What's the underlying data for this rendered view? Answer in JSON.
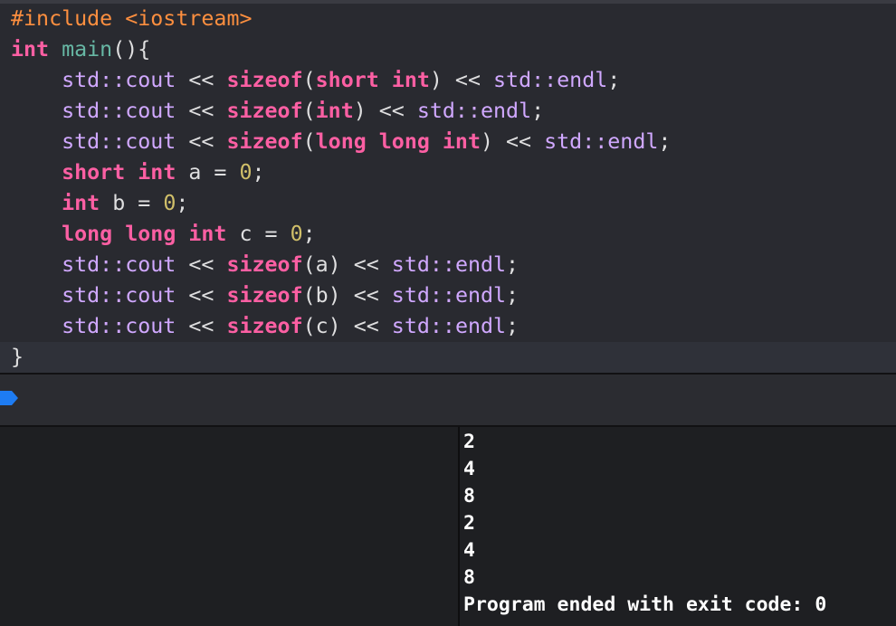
{
  "editor": {
    "lines": [
      [
        {
          "t": "#include <iostream>",
          "c": "pre"
        }
      ],
      [
        {
          "t": "int",
          "c": "kw"
        },
        {
          "t": " ",
          "c": "plain"
        },
        {
          "t": "main",
          "c": "func"
        },
        {
          "t": "(){",
          "c": "plain"
        }
      ],
      [
        {
          "t": "    std::",
          "c": "ns"
        },
        {
          "t": "cout",
          "c": "ns"
        },
        {
          "t": " << ",
          "c": "plain"
        },
        {
          "t": "sizeof",
          "c": "kw"
        },
        {
          "t": "(",
          "c": "plain"
        },
        {
          "t": "short int",
          "c": "kw"
        },
        {
          "t": ") << ",
          "c": "plain"
        },
        {
          "t": "std::",
          "c": "ns"
        },
        {
          "t": "endl",
          "c": "ns"
        },
        {
          "t": ";",
          "c": "plain"
        }
      ],
      [
        {
          "t": "    std::",
          "c": "ns"
        },
        {
          "t": "cout",
          "c": "ns"
        },
        {
          "t": " << ",
          "c": "plain"
        },
        {
          "t": "sizeof",
          "c": "kw"
        },
        {
          "t": "(",
          "c": "plain"
        },
        {
          "t": "int",
          "c": "kw"
        },
        {
          "t": ") << ",
          "c": "plain"
        },
        {
          "t": "std::",
          "c": "ns"
        },
        {
          "t": "endl",
          "c": "ns"
        },
        {
          "t": ";",
          "c": "plain"
        }
      ],
      [
        {
          "t": "    std::",
          "c": "ns"
        },
        {
          "t": "cout",
          "c": "ns"
        },
        {
          "t": " << ",
          "c": "plain"
        },
        {
          "t": "sizeof",
          "c": "kw"
        },
        {
          "t": "(",
          "c": "plain"
        },
        {
          "t": "long long int",
          "c": "kw"
        },
        {
          "t": ") << ",
          "c": "plain"
        },
        {
          "t": "std::",
          "c": "ns"
        },
        {
          "t": "endl",
          "c": "ns"
        },
        {
          "t": ";",
          "c": "plain"
        }
      ],
      [
        {
          "t": "    ",
          "c": "plain"
        },
        {
          "t": "short int",
          "c": "kw"
        },
        {
          "t": " a = ",
          "c": "plain"
        },
        {
          "t": "0",
          "c": "num"
        },
        {
          "t": ";",
          "c": "plain"
        }
      ],
      [
        {
          "t": "    ",
          "c": "plain"
        },
        {
          "t": "int",
          "c": "kw"
        },
        {
          "t": " b = ",
          "c": "plain"
        },
        {
          "t": "0",
          "c": "num"
        },
        {
          "t": ";",
          "c": "plain"
        }
      ],
      [
        {
          "t": "    ",
          "c": "plain"
        },
        {
          "t": "long long int",
          "c": "kw"
        },
        {
          "t": " c = ",
          "c": "plain"
        },
        {
          "t": "0",
          "c": "num"
        },
        {
          "t": ";",
          "c": "plain"
        }
      ],
      [
        {
          "t": "    std::",
          "c": "ns"
        },
        {
          "t": "cout",
          "c": "ns"
        },
        {
          "t": " << ",
          "c": "plain"
        },
        {
          "t": "sizeof",
          "c": "kw"
        },
        {
          "t": "(a) << ",
          "c": "plain"
        },
        {
          "t": "std::",
          "c": "ns"
        },
        {
          "t": "endl",
          "c": "ns"
        },
        {
          "t": ";",
          "c": "plain"
        }
      ],
      [
        {
          "t": "    std::",
          "c": "ns"
        },
        {
          "t": "cout",
          "c": "ns"
        },
        {
          "t": " << ",
          "c": "plain"
        },
        {
          "t": "sizeof",
          "c": "kw"
        },
        {
          "t": "(b) << ",
          "c": "plain"
        },
        {
          "t": "std::",
          "c": "ns"
        },
        {
          "t": "endl",
          "c": "ns"
        },
        {
          "t": ";",
          "c": "plain"
        }
      ],
      [
        {
          "t": "    std::",
          "c": "ns"
        },
        {
          "t": "cout",
          "c": "ns"
        },
        {
          "t": " << ",
          "c": "plain"
        },
        {
          "t": "sizeof",
          "c": "kw"
        },
        {
          "t": "(c) << ",
          "c": "plain"
        },
        {
          "t": "std::",
          "c": "ns"
        },
        {
          "t": "endl",
          "c": "ns"
        },
        {
          "t": ";",
          "c": "plain"
        }
      ],
      [
        {
          "t": "}",
          "c": "plain"
        }
      ]
    ],
    "current_line": 11
  },
  "debug_bar": {
    "marker_icon": "debug-location-marker-icon",
    "marker_color": "#1e7cf2"
  },
  "console": {
    "lines": [
      "2",
      "4",
      "8",
      "2",
      "4",
      "8",
      "Program ended with exit code: 0"
    ]
  },
  "colors": {
    "preprocessor": "#fd8f3f",
    "keyword": "#fc5fa3",
    "function": "#67b7a4",
    "namespace": "#d0a8ff",
    "plain": "#dfdfe0",
    "number": "#d0bf69"
  }
}
